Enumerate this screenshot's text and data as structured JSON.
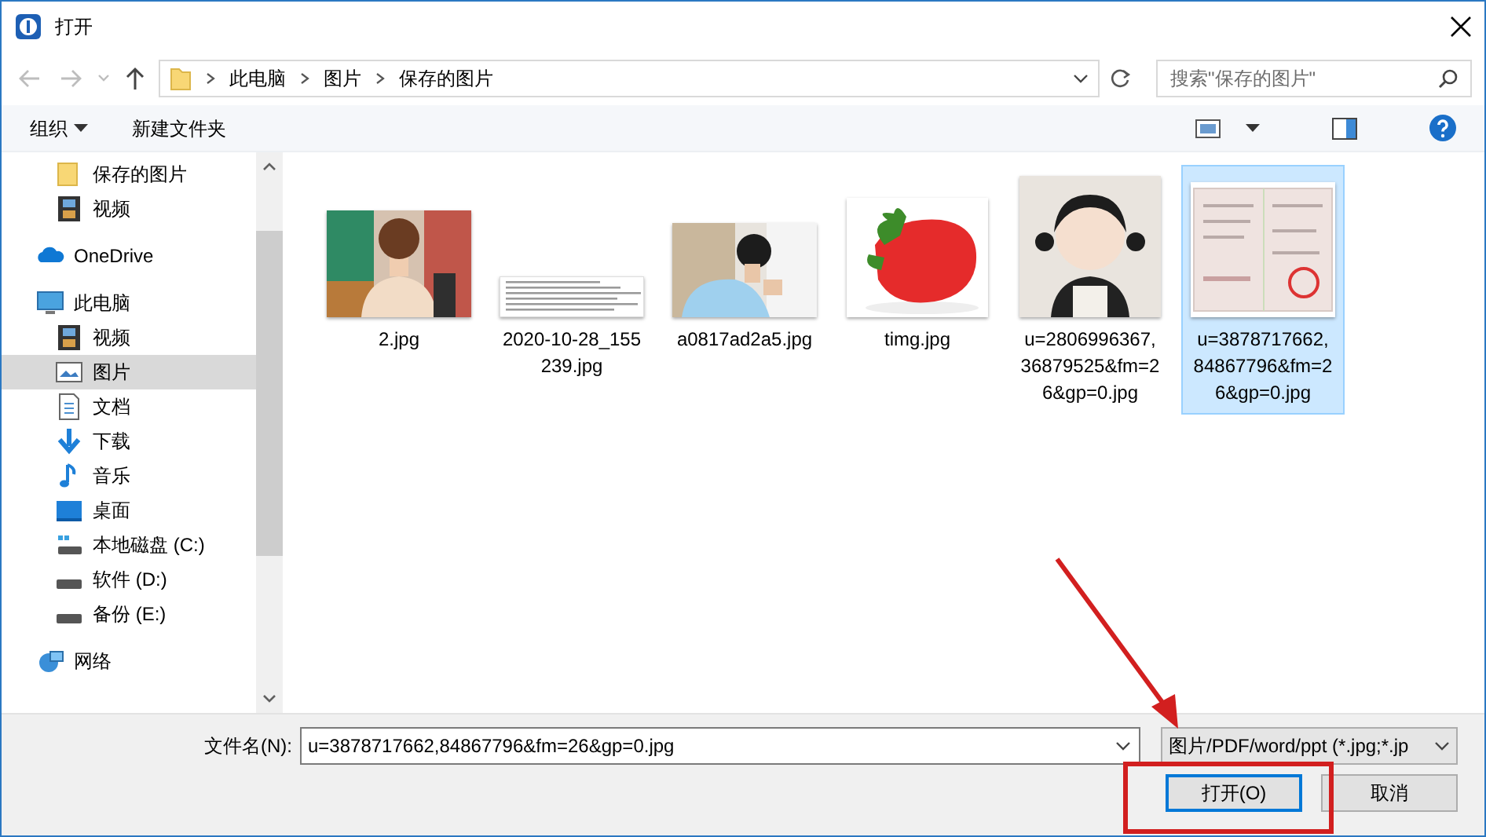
{
  "window": {
    "title": "打开"
  },
  "address": {
    "crumbs": [
      "此电脑",
      "图片",
      "保存的图片"
    ]
  },
  "search": {
    "placeholder": "搜索\"保存的图片\""
  },
  "toolbar": {
    "organize": "组织",
    "new_folder": "新建文件夹"
  },
  "sidebar": {
    "quick_access_children": [
      {
        "label": "保存的图片",
        "kind": "folder",
        "selected": false
      },
      {
        "label": "视频",
        "kind": "video",
        "selected": false
      }
    ],
    "items": [
      {
        "label": "OneDrive",
        "kind": "cloud",
        "selected": false
      },
      {
        "label": "此电脑",
        "kind": "pc",
        "selected": false,
        "children": [
          {
            "label": "视频",
            "kind": "video",
            "selected": false
          },
          {
            "label": "图片",
            "kind": "pictures",
            "selected": true
          },
          {
            "label": "文档",
            "kind": "document",
            "selected": false
          },
          {
            "label": "下载",
            "kind": "download",
            "selected": false
          },
          {
            "label": "音乐",
            "kind": "music",
            "selected": false
          },
          {
            "label": "桌面",
            "kind": "desktop",
            "selected": false
          },
          {
            "label": "本地磁盘 (C:)",
            "kind": "system-drive",
            "selected": false
          },
          {
            "label": "软件 (D:)",
            "kind": "drive",
            "selected": false
          },
          {
            "label": "备份 (E:)",
            "kind": "drive",
            "selected": false
          }
        ]
      },
      {
        "label": "网络",
        "kind": "network",
        "selected": false
      }
    ]
  },
  "files": [
    {
      "name": "2.jpg",
      "kind": "picture",
      "selected": false
    },
    {
      "name": "2020-10-28_155239.jpg",
      "kind": "picture",
      "selected": false
    },
    {
      "name": "a0817ad2a5.jpg",
      "kind": "picture",
      "selected": false
    },
    {
      "name": "timg.jpg",
      "kind": "picture",
      "selected": false
    },
    {
      "name": "u=2806996367,36879525&fm=26&gp=0.jpg",
      "kind": "picture",
      "selected": false
    },
    {
      "name": "u=3878717662,84867796&fm=26&gp=0.jpg",
      "kind": "picture",
      "selected": true
    }
  ],
  "footer": {
    "filename_label": "文件名(N):",
    "filename_value": "u=3878717662,84867796&fm=26&gp=0.jpg",
    "file_type": "图片/PDF/word/ppt (*.jpg;*.jp",
    "open_button": {
      "label": "打开(O)",
      "highlighted": true
    },
    "cancel_button": {
      "label": "取消"
    }
  },
  "callout_arrow": true
}
